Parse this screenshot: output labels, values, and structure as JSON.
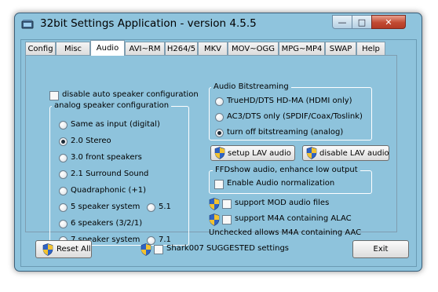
{
  "window": {
    "title": "32bit Settings Application - version 4.5.5",
    "close_glyph": "✕",
    "minimize_glyph": "—",
    "maximize_glyph": "□"
  },
  "tabs": [
    {
      "label": "Config"
    },
    {
      "label": "Misc"
    },
    {
      "label": "Audio",
      "active": true
    },
    {
      "label": "AVI~RM"
    },
    {
      "label": "H264/5"
    },
    {
      "label": "MKV"
    },
    {
      "label": "MOV~OGG"
    },
    {
      "label": "MPG~MP4"
    },
    {
      "label": "SWAP"
    },
    {
      "label": "Help"
    }
  ],
  "audio": {
    "disable_auto_label": "disable auto speaker configuration",
    "disable_auto_checked": false,
    "analog_group_title": "analog speaker configuration",
    "speaker_options": [
      {
        "label": "Same as input (digital)",
        "selected": false
      },
      {
        "label": "2.0 Stereo",
        "selected": true
      },
      {
        "label": "3.0 front speakers",
        "selected": false
      },
      {
        "label": "2.1 Surround Sound",
        "selected": false
      },
      {
        "label": "Quadraphonic (+1)",
        "selected": false
      },
      {
        "label": "5 speaker system",
        "selected": false
      },
      {
        "label": "5.1",
        "selected": false
      },
      {
        "label": "6 speakers (3/2/1)",
        "selected": false
      },
      {
        "label": "7 speaker system",
        "selected": false
      },
      {
        "label": "7.1",
        "selected": false
      }
    ],
    "bitstream_group_title": "Audio Bitstreaming",
    "bitstream_options": [
      {
        "label": "TrueHD/DTS HD-MA (HDMI only)",
        "selected": false
      },
      {
        "label": "AC3/DTS only (SPDIF/Coax/Toslink)",
        "selected": false
      },
      {
        "label": "turn off bitstreaming (analog)",
        "selected": true
      }
    ],
    "setup_lav_label": "setup LAV audio",
    "disable_lav_label": "disable LAV audio",
    "ffdshow_group_title": "FFDshow audio, enhance low output",
    "normalization_label": "Enable Audio normalization",
    "normalization_checked": false,
    "mod_label": "support MOD audio files",
    "mod_checked": false,
    "m4a_label": "support M4A containing ALAC",
    "m4a_checked": false,
    "unchecked_note": "Unchecked allows M4A containing AAC"
  },
  "footer": {
    "reset_label": "Reset All",
    "suggested_label": "Shark007 SUGGESTED settings",
    "suggested_checked": false,
    "exit_label": "Exit"
  },
  "colors": {
    "client_bg": "#8ec3dc",
    "close_red": "#c24a32",
    "shield_blue": "#2f63c4",
    "shield_yellow": "#f2c230"
  }
}
